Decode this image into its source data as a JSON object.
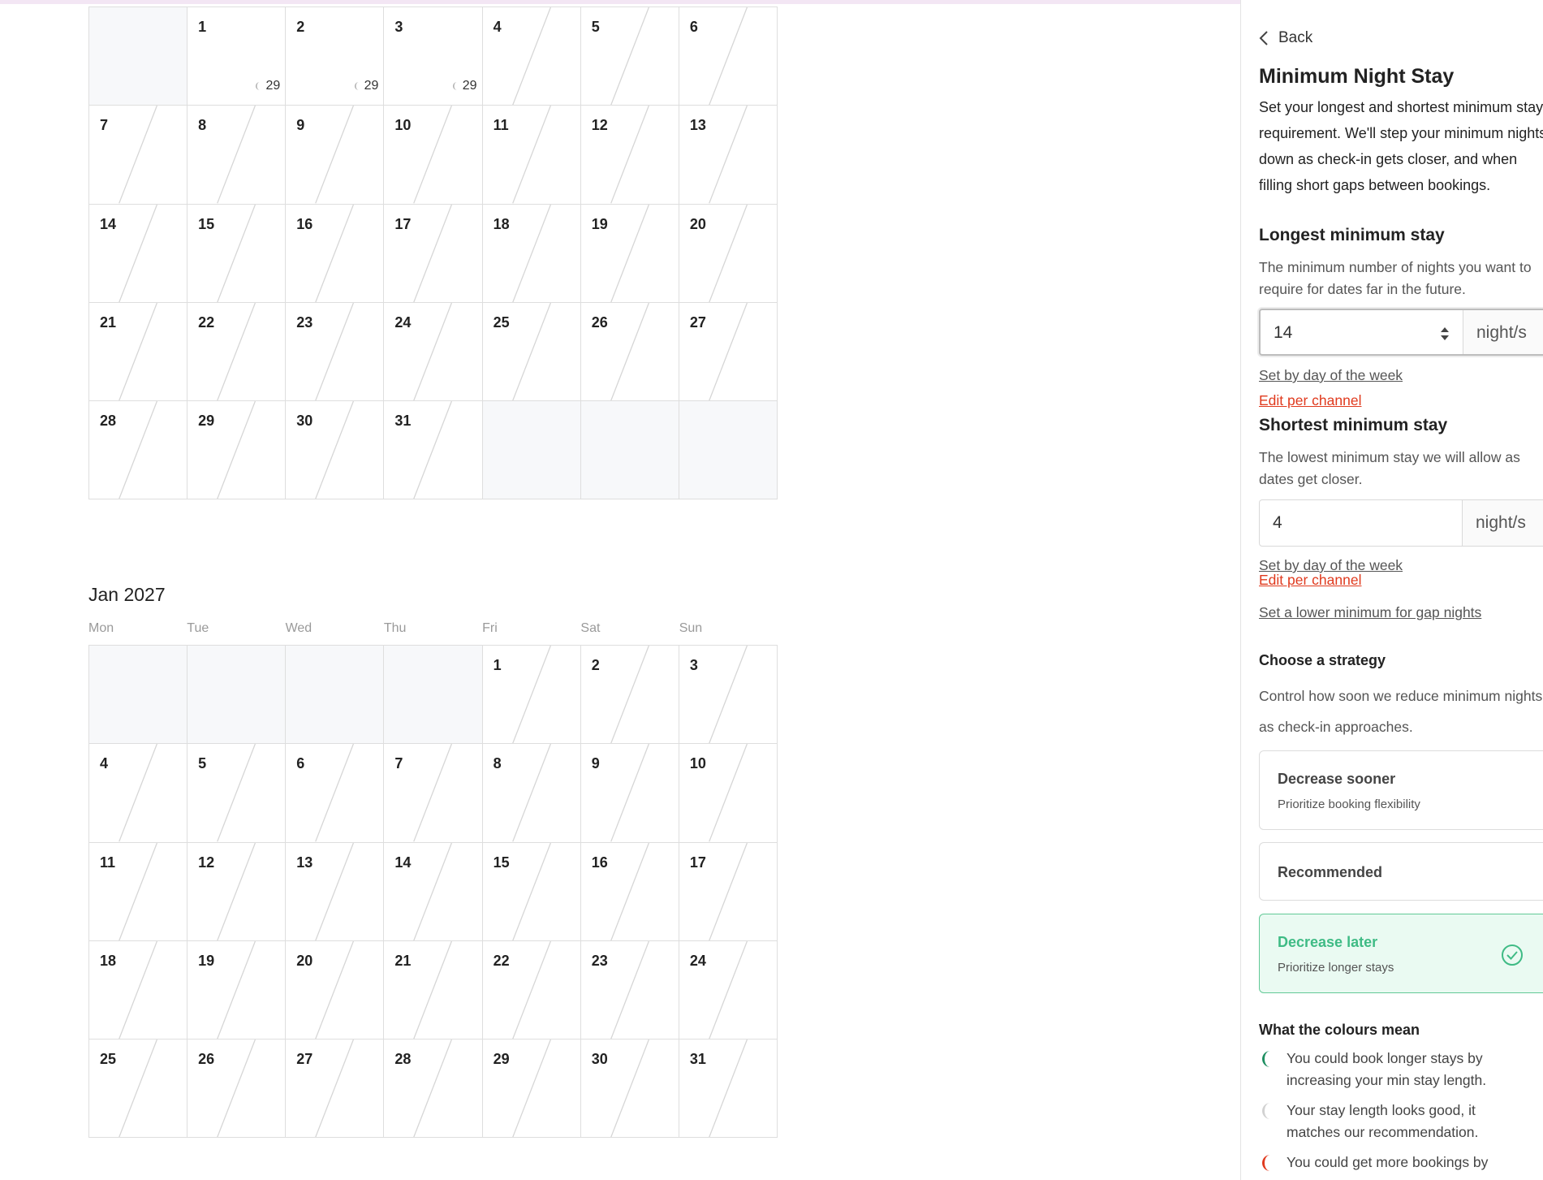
{
  "calendar": {
    "weekdays": [
      "Mon",
      "Tue",
      "Wed",
      "Thu",
      "Fri",
      "Sat",
      "Sun"
    ],
    "months": [
      {
        "title": "",
        "leading_empty": 1,
        "days": 31,
        "min_stay_labels": {
          "1": "29",
          "2": "29",
          "3": "29"
        },
        "non_hatched_days": [
          1,
          2,
          3
        ]
      },
      {
        "title": "Jan 2027",
        "leading_empty": 4,
        "days": 31,
        "min_stay_labels": {},
        "non_hatched_days": []
      }
    ]
  },
  "panel": {
    "back_label": "Back",
    "title": "Minimum Night Stay",
    "description": "Set your longest and shortest minimum stay requirement. We'll step your minimum nights down as check-in gets closer, and when filling short gaps between bookings.",
    "longest": {
      "heading": "Longest minimum stay",
      "description": "The minimum number of nights you want to require for dates far in the future.",
      "value": "14",
      "unit": "night/s",
      "link_day_of_week": "Set by day of the week",
      "link_per_channel": "Edit per channel"
    },
    "shortest": {
      "heading": "Shortest minimum stay",
      "description": "The lowest minimum stay we will allow as dates get closer.",
      "value": "4",
      "unit": "night/s",
      "link_day_of_week": "Set by day of the week",
      "link_per_channel": "Edit per channel"
    },
    "gap_link": "Set a lower minimum for gap nights",
    "strategy": {
      "heading": "Choose a strategy",
      "description": "Control how soon we reduce minimum nights as check-in approaches.",
      "options": [
        {
          "title": "Decrease sooner",
          "subtitle": "Prioritize booking flexibility"
        },
        {
          "title": "Recommended",
          "subtitle": ""
        },
        {
          "title": "Decrease later",
          "subtitle": "Prioritize longer stays"
        }
      ],
      "selected_index": 2
    },
    "legend": {
      "heading": "What the colours mean",
      "items": [
        {
          "text": "You could book longer stays by increasing your min stay length.",
          "color": "#1f8f62"
        },
        {
          "text": "Your stay length looks good, it matches our recommendation.",
          "color": "#d2d2d2"
        },
        {
          "text": "You could get more bookings by",
          "color": "#e03a1e"
        }
      ]
    }
  }
}
